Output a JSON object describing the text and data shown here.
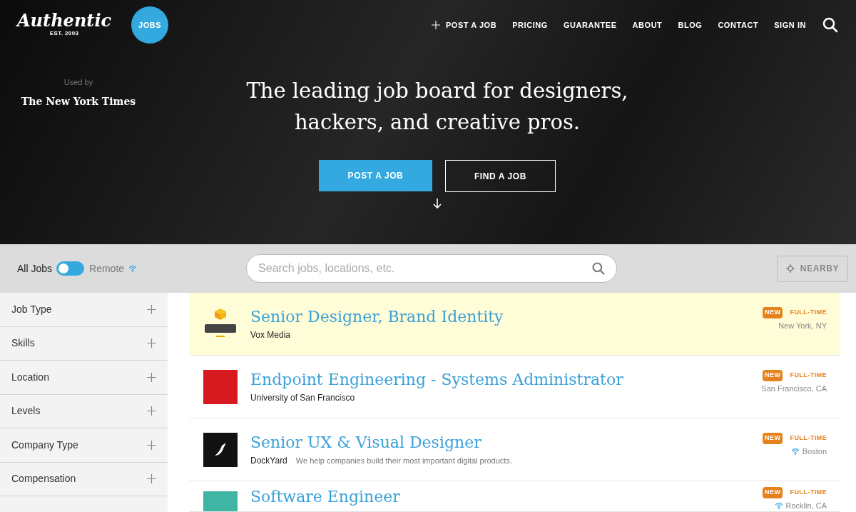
{
  "brand": {
    "logo": "Authentic",
    "est": "EST. 2003",
    "badge": "JOBS"
  },
  "nav": {
    "post": "POST A JOB",
    "links": [
      "PRICING",
      "GUARANTEE",
      "ABOUT",
      "BLOG",
      "CONTACT",
      "SIGN IN"
    ]
  },
  "hero": {
    "used_by": "Used by",
    "client": "The New York Times",
    "headline_1": "The leading job board for designers,",
    "headline_2": "hackers, and creative pros.",
    "primary": "POST A JOB",
    "secondary": "FIND A JOB"
  },
  "filter_bar": {
    "all_label": "All Jobs",
    "remote_label": "Remote",
    "remote_on": false,
    "search_placeholder": "Search jobs, locations, etc.",
    "nearby": "NEARBY"
  },
  "filters": [
    {
      "label": "Job Type",
      "expanded": false
    },
    {
      "label": "Skills",
      "expanded": false
    },
    {
      "label": "Location",
      "expanded": false
    },
    {
      "label": "Levels",
      "expanded": false
    },
    {
      "label": "Company Type",
      "expanded": false
    },
    {
      "label": "Compensation",
      "expanded": false
    }
  ],
  "jobs": [
    {
      "title": "Senior Designer, Brand Identity",
      "company": "Vox Media",
      "badge": "NEW",
      "type": "FULL-TIME",
      "location": "New York, NY",
      "remote": false,
      "highlighted": true,
      "kind": "vox"
    },
    {
      "title": "Endpoint Engineering - Systems Administrator",
      "company": "University of San Francisco",
      "badge": "NEW",
      "type": "FULL-TIME",
      "location": "San Francisco, CA",
      "remote": false,
      "highlighted": false,
      "kind": "red"
    },
    {
      "title": "Senior UX & Visual Designer",
      "company": "DockYard",
      "tagline": "We help companies build their most important digital products.",
      "badge": "NEW",
      "type": "FULL-TIME",
      "location": "Boston",
      "remote": true,
      "highlighted": false,
      "kind": "black"
    },
    {
      "title": "Software Engineer",
      "badge": "NEW",
      "type": "FULL-TIME",
      "location": "Rocklin, CA",
      "remote": true,
      "highlighted": false,
      "kind": "teal"
    }
  ]
}
